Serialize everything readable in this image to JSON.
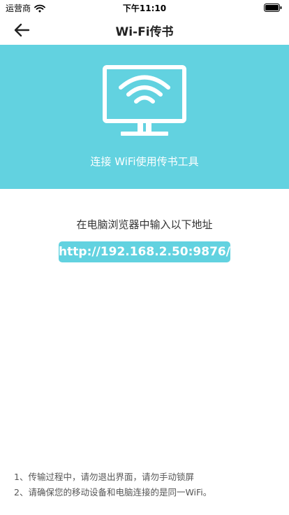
{
  "status_bar": {
    "carrier": "运营商",
    "time": "下午11:10",
    "icons": [
      "wifi-signal-icon",
      "battery-icon"
    ]
  },
  "nav": {
    "title": "Wi-Fi传书",
    "back_icon": "arrow-left-icon"
  },
  "hero": {
    "icon": "monitor-wifi-icon",
    "caption": "连接 WiFi使用传书工具"
  },
  "main": {
    "instruction": "在电脑浏览器中输入以下地址",
    "url": "http://192.168.2.50:9876/"
  },
  "notes": [
    "1、传输过程中，请勿退出界面，请勿手动锁屏",
    "2、请确保您的移动设备和电脑连接的是同一WiFi。"
  ],
  "colors": {
    "accent": "#62d2e0",
    "background": "#ffffff",
    "text": "#333333"
  }
}
